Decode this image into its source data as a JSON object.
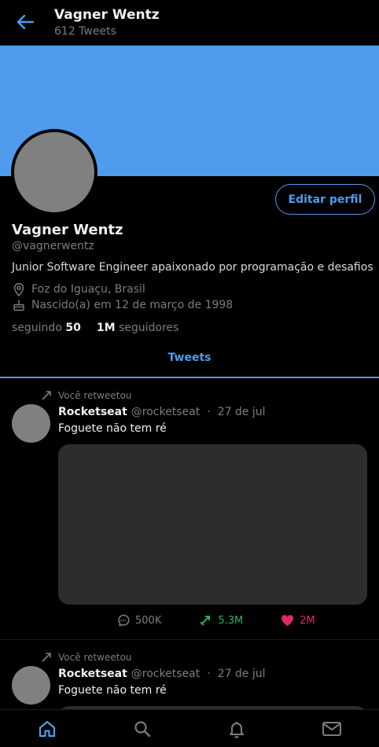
{
  "header": {
    "title": "Vagner Wentz",
    "subtitle": "612 Tweets",
    "back_icon": "arrow-left-icon"
  },
  "profile": {
    "name": "Vagner Wentz",
    "handle": "@vagnerwentz",
    "bio": "Junior Software Engineer apaixonado por programação e desafios",
    "location": "Foz do Iguaçu, Brasil",
    "birthday": "Nascido(a) em 12 de março de 1998",
    "edit_label": "Editar perfil",
    "following_label": "seguindo",
    "following_count": "50",
    "followers_count": "1M",
    "followers_label": "seguidores",
    "banner_color": "#4f9cee"
  },
  "tabs": {
    "active": "Tweets"
  },
  "tweets": [
    {
      "retweet_label": "Você retweetou",
      "author": "Rocketseat",
      "handle": "@rocketseat",
      "separator": "·",
      "date": "27 de jul",
      "text": "Foguete não tem ré",
      "comments": "500K",
      "retweets": "5.3M",
      "likes": "2M"
    },
    {
      "retweet_label": "Você retweetou",
      "author": "Rocketseat",
      "handle": "@rocketseat",
      "separator": "·",
      "date": "27 de jul",
      "text": "Foguete não tem ré"
    }
  ],
  "colors": {
    "accent": "#4f9cee",
    "retweet": "#22b45e",
    "like": "#e2266e",
    "muted": "#7a7d80",
    "media_bg": "#2b2d2f"
  },
  "nav": {
    "items": [
      "home-icon",
      "search-icon",
      "bell-icon",
      "mail-icon"
    ],
    "active": "home-icon"
  }
}
